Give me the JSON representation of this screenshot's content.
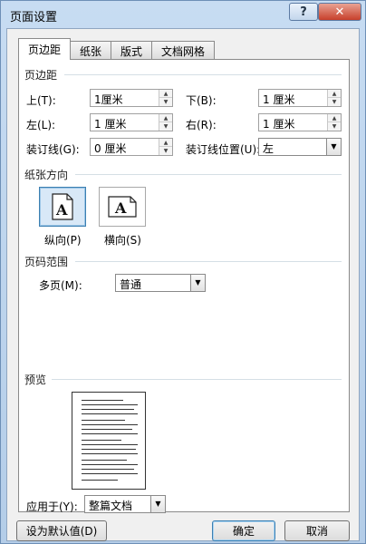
{
  "window": {
    "title": "页面设置",
    "help": "?",
    "close": "✕"
  },
  "tabs": [
    "页边距",
    "纸张",
    "版式",
    "文档网格"
  ],
  "margins": {
    "section": "页边距",
    "top_label": "上(T):",
    "top_value": "1厘米",
    "bottom_label": "下(B):",
    "bottom_value": "1 厘米",
    "left_label": "左(L):",
    "left_value": "1 厘米",
    "right_label": "右(R):",
    "right_value": "1 厘米",
    "gutter_label": "装订线(G):",
    "gutter_value": "0 厘米",
    "gutter_pos_label": "装订线位置(U):",
    "gutter_pos_value": "左"
  },
  "orientation": {
    "section": "纸张方向",
    "portrait": "纵向(P)",
    "landscape": "横向(S)",
    "glyph": "A"
  },
  "pages": {
    "section": "页码范围",
    "label": "多页(M):",
    "value": "普通"
  },
  "preview": {
    "section": "预览"
  },
  "apply": {
    "label": "应用于(Y):",
    "value": "整篇文档"
  },
  "buttons": {
    "set_default": "设为默认值(D)",
    "ok": "确定",
    "cancel": "取消"
  },
  "colors": {
    "accent": "#3c7fb1",
    "close": "#c7402b",
    "frame": "#b4cde8"
  }
}
